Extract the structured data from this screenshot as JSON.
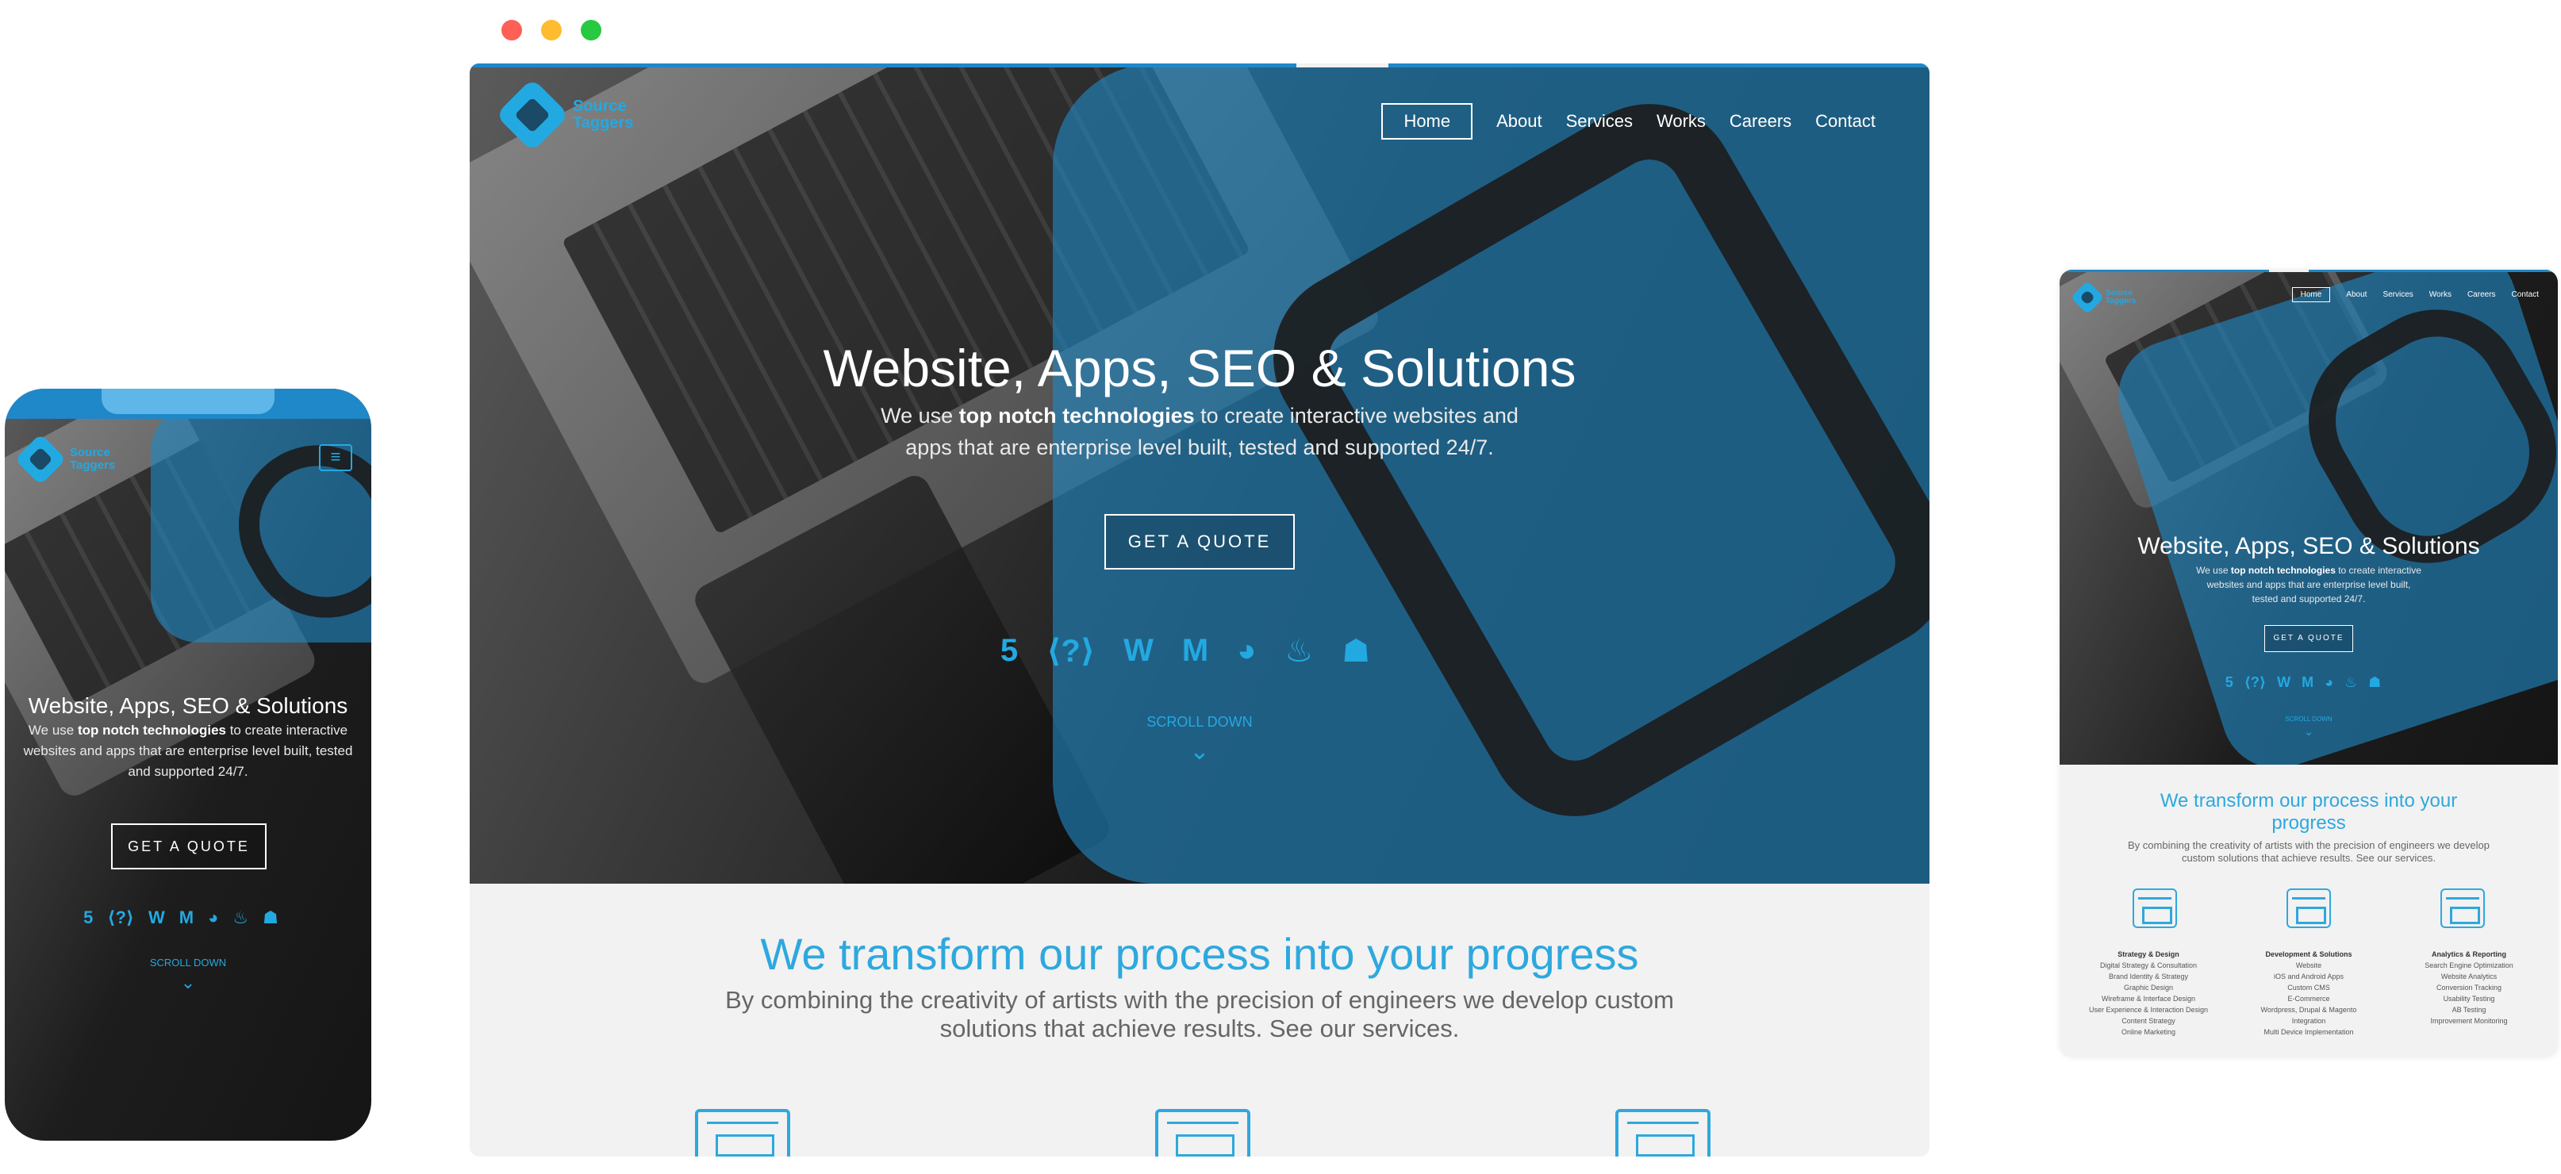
{
  "brand": {
    "name_line1": "Source",
    "name_line2": "Taggers"
  },
  "nav": {
    "items": [
      "Home",
      "About",
      "Services",
      "Works",
      "Careers",
      "Contact"
    ],
    "active": "Home",
    "menu_icon": "≡"
  },
  "hero": {
    "title": "Website, Apps, SEO & Solutions",
    "subtitle_pre": "We use ",
    "subtitle_bold": "top notch technologies",
    "subtitle_post": " to create interactive websites and apps that are enterprise level built, tested and supported 24/7.",
    "cta": "GET A QUOTE",
    "scroll_label": "SCROLL DOWN",
    "scroll_icon": "⌄",
    "tech_icons": [
      {
        "name": "html5-icon",
        "glyph": "5"
      },
      {
        "name": "php-icon",
        "glyph": "⟨?⟩"
      },
      {
        "name": "wordpress-icon",
        "glyph": "W"
      },
      {
        "name": "magento-icon",
        "glyph": "M"
      },
      {
        "name": "drupal-icon",
        "glyph": "◕"
      },
      {
        "name": "java-icon",
        "glyph": "♨"
      },
      {
        "name": "android-icon",
        "glyph": "☗"
      },
      {
        "name": "apple-icon",
        "glyph": ""
      }
    ]
  },
  "process": {
    "title": "We transform our process into your progress",
    "subtitle": "By combining the creativity of artists with the precision of engineers we develop custom solutions that achieve results. See our services."
  },
  "services": [
    {
      "heading": "Strategy & Design",
      "items": [
        "Digital Strategy & Consultation",
        "Brand Identity & Strategy",
        "Graphic Design",
        "Wireframe & Interface Design",
        "User Experience & Interaction Design",
        "Content Strategy",
        "Online Marketing"
      ]
    },
    {
      "heading": "Development & Solutions",
      "items": [
        "Website",
        "iOS and Android Apps",
        "Custom CMS",
        "E-Commerce",
        "Wordpress, Drupal & Magento",
        "Integration",
        "Multi Device Implementation"
      ]
    },
    {
      "heading": "Analytics & Reporting",
      "items": [
        "Search Engine Optimization",
        "Website Analytics",
        "Conversion Tracking",
        "Usability Testing",
        "AB Testing",
        "Improvement Monitoring"
      ]
    }
  ],
  "colors": {
    "accent": "#23a9e1",
    "topbar": "#1e88c9",
    "pane": "#2288c4"
  }
}
